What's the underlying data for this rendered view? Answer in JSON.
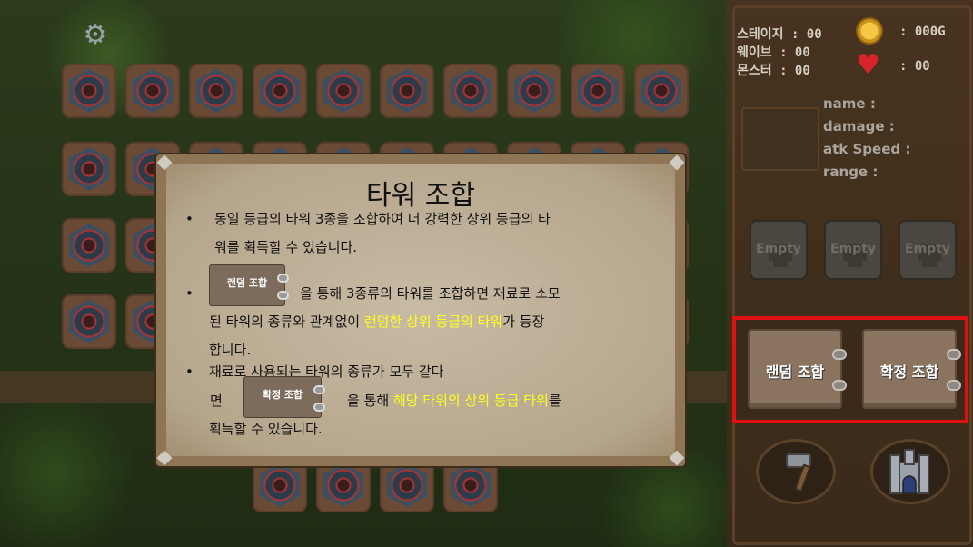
{
  "hud": {
    "stage_label": "스테이지 : 00",
    "wave_label": "웨이브 : 00",
    "monster_label": "몬스터 : 00",
    "gold_value": ": 000G",
    "life_value": ": 00"
  },
  "tower_info": {
    "name_label": "name :",
    "damage_label": "damage :",
    "atk_speed_label": "atk Speed :",
    "range_label": "range :"
  },
  "slots": [
    {
      "label": "Empty"
    },
    {
      "label": "Empty"
    },
    {
      "label": "Empty"
    }
  ],
  "buttons": {
    "random_combine": "랜덤 조합",
    "confirmed_combine": "확정 조합"
  },
  "dialog": {
    "title": "타워 조합",
    "b1_line1": "동일 등급의 타워 3종을 조합하여 더 강력한 상위 등급의 타",
    "b1_line2": "워를 획득할 수 있습니다.",
    "b2_btn": "랜덤 조합",
    "b2_line1": "을 통해 3종류의 타워를 조합하면 재료로 소모",
    "b2_line2_pre": "된 타워의 종류와 관계없이 ",
    "b2_line2_hl": "랜덤한 상위 등급의 타워",
    "b2_line2_post": "가 등장",
    "b2_line3": "합니다.",
    "b3_line1": "재료로 사용되는 타워의 종류가 모두 같다",
    "b3_line2_pre": "면",
    "b3_btn": "확정 조합",
    "b3_line2_mid": "을 통해 ",
    "b3_line2_hl": "해당 타워의 상위 등급 타워",
    "b3_line2_post": "를",
    "b3_line3": "획득할 수 있습니다.",
    "bullet": "•"
  },
  "icons": [
    "settings-gear-icon",
    "gold-coin-icon",
    "heart-icon",
    "hammer-icon",
    "castle-icon"
  ],
  "colors": {
    "highlight": "#e01010",
    "accent_text": "#ffff1a"
  }
}
